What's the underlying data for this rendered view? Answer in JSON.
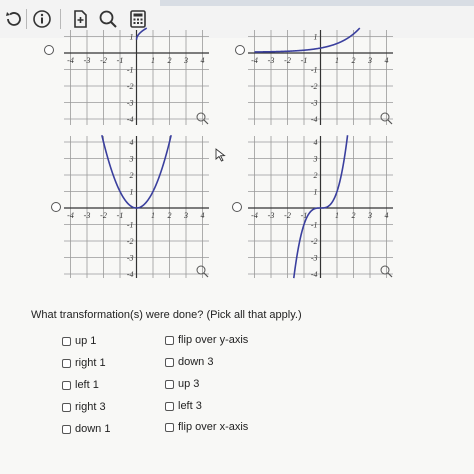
{
  "toolbar": {
    "icons": [
      "refresh-icon",
      "info-icon",
      "document-plus-icon",
      "search-icon",
      "calculator-icon"
    ]
  },
  "graphs": [
    {
      "id": "a",
      "curve": "sqrt shifted up 1",
      "x_ticks": [
        "-4",
        "-3",
        "-2",
        "-1",
        "",
        "1",
        "2",
        "3",
        "4"
      ],
      "y_ticks": [
        "1",
        "-1",
        "-2",
        "-3",
        "-4"
      ]
    },
    {
      "id": "b",
      "curve": "exponential-like shifted",
      "x_ticks": [
        "-4",
        "-3",
        "-2",
        "-1",
        "",
        "1",
        "2",
        "3",
        "4"
      ],
      "y_ticks": [
        "1",
        "-1",
        "-2",
        "-3",
        "-4"
      ]
    },
    {
      "id": "c",
      "curve": "parabola",
      "x_ticks": [
        "-4",
        "-3",
        "-2",
        "-1",
        "",
        "1",
        "2",
        "3",
        "4"
      ],
      "y_ticks": [
        "4",
        "3",
        "2",
        "1",
        "-1",
        "-2",
        "-3",
        "-4"
      ]
    },
    {
      "id": "d",
      "curve": "cubic",
      "x_ticks": [
        "-4",
        "-3",
        "-2",
        "-1",
        "",
        "1",
        "2",
        "3",
        "4"
      ],
      "y_ticks": [
        "4",
        "3",
        "2",
        "1",
        "-1",
        "-2",
        "-3",
        "-4"
      ]
    }
  ],
  "question": "What transformation(s) were done? (Pick all that apply.)",
  "options_left": [
    "up 1",
    "right 1",
    "left 1",
    "right 3",
    "down 1"
  ],
  "options_right": [
    "flip over y-axis",
    "down 3",
    "up 3",
    "left 3",
    "flip over x-axis"
  ],
  "colors": {
    "curve": "#3a3f9e",
    "grid": "#9a9a9a",
    "axis": "#333333"
  }
}
